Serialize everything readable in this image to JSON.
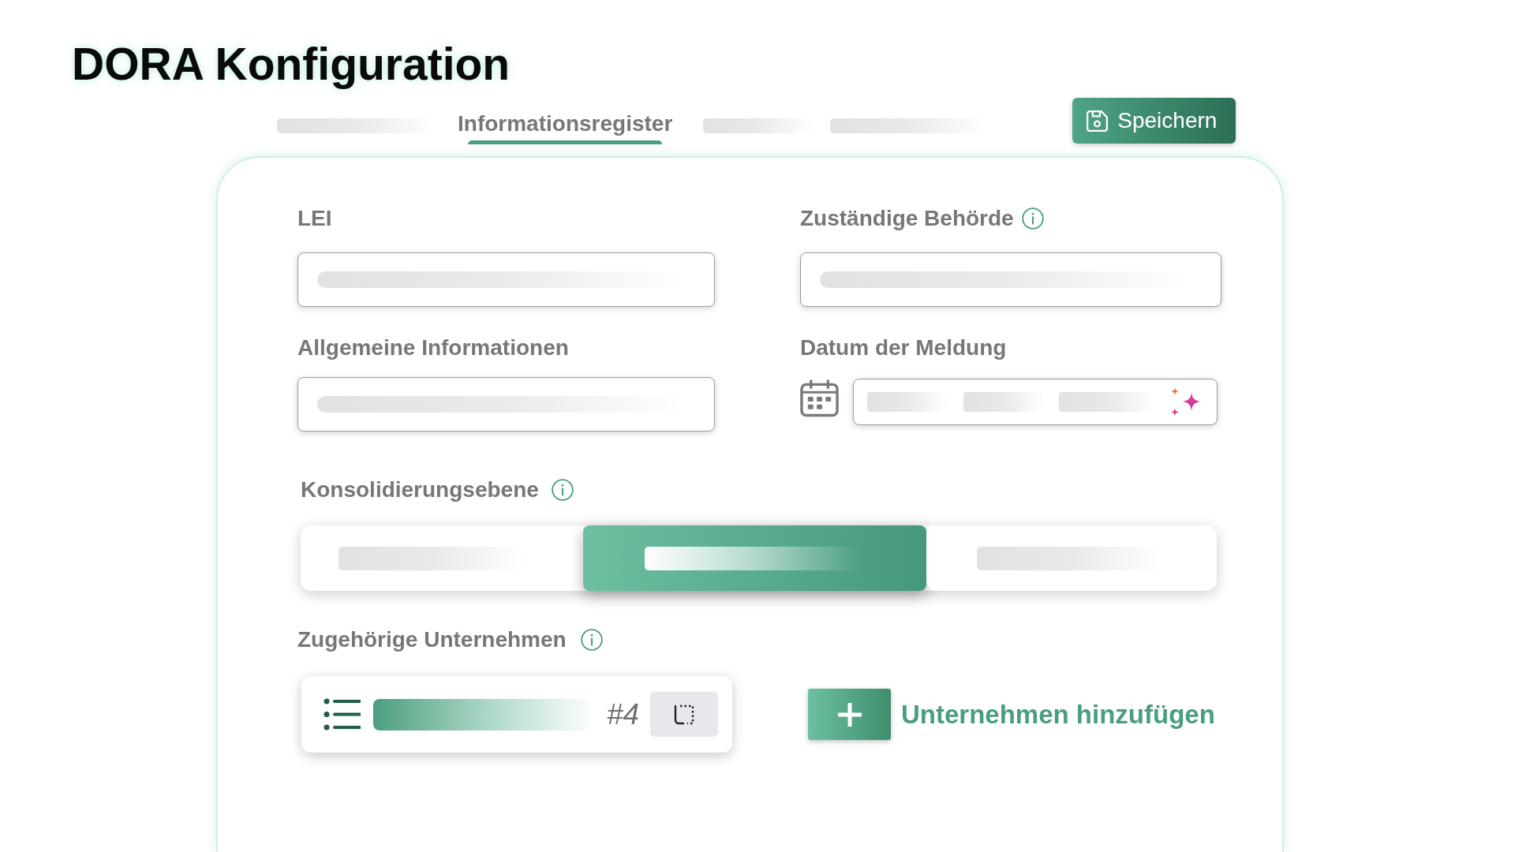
{
  "title": "DORA Konfiguration",
  "tabs": [
    {
      "selected": false
    },
    {
      "label": "Informationsregister",
      "selected": true
    },
    {
      "selected": false
    },
    {
      "selected": false
    }
  ],
  "save_button": {
    "label": "Speichern"
  },
  "form": {
    "fields": [
      {
        "kind": "text",
        "label": "LEI",
        "info": false
      },
      {
        "kind": "text",
        "label": "Zuständige Behörde",
        "info": true
      },
      {
        "kind": "text",
        "label": "Allgemeine Informationen",
        "info": false
      },
      {
        "kind": "date",
        "label": "Datum der Meldung",
        "info": false
      }
    ],
    "consolidation": {
      "label": "Konsolidierungsebene",
      "info": true,
      "options": [
        {
          "selected": false
        },
        {
          "selected": true
        },
        {
          "selected": false
        }
      ]
    },
    "related_companies": {
      "label": "Zugehörige Unternehmen",
      "info": true,
      "entry": {
        "number": "#4"
      },
      "add_button": {
        "label": "Unternehmen hinzufügen"
      }
    }
  }
}
